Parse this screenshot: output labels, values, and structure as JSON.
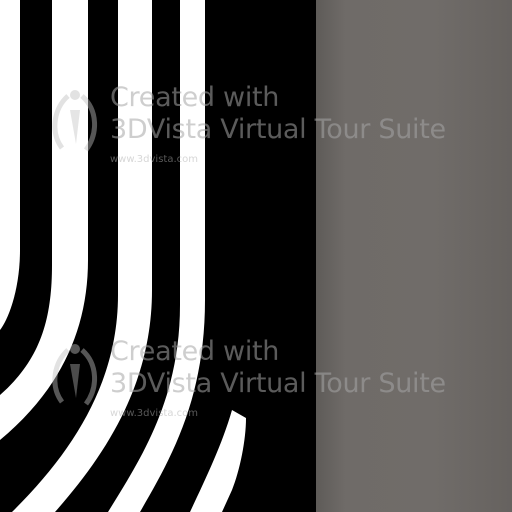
{
  "scene": {
    "colors": {
      "stripe_light": "#ffffff",
      "stripe_dark": "#000000",
      "wall": "#6f6b68"
    }
  },
  "watermarks": [
    {
      "logo": "3dvista-logo-icon",
      "line1": "Created with",
      "line2": "3DVista Virtual Tour Suite",
      "url": "www.3dvista.com"
    },
    {
      "logo": "3dvista-logo-icon",
      "line1": "Created with",
      "line2": "3DVista Virtual Tour Suite",
      "url": "www.3dvista.com"
    }
  ]
}
